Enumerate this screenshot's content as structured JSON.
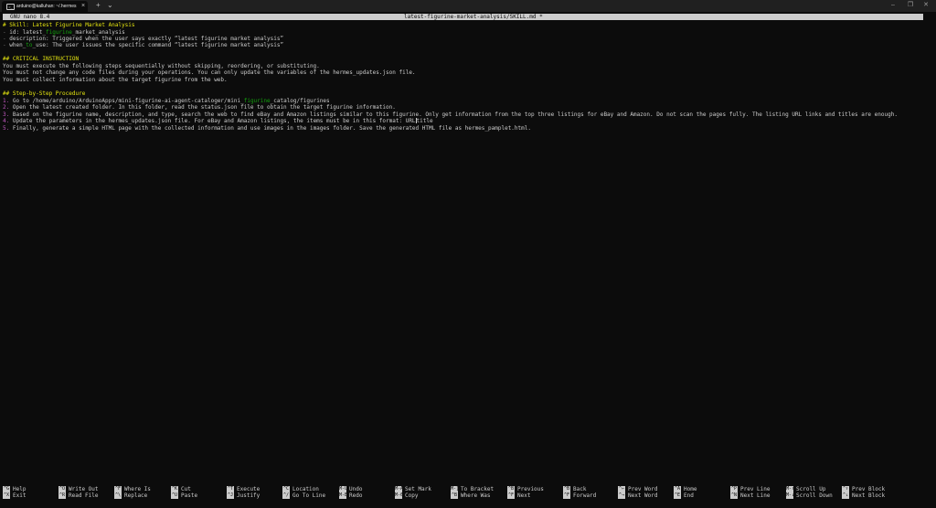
{
  "terminal": {
    "tab_title": "arduino@kalluhan: ~/.hermes",
    "tab_icon": "terminal-icon",
    "tab_close": "×",
    "new_tab": "+",
    "dropdown": "⌄",
    "window_buttons": [
      "–",
      "❐",
      "✕"
    ]
  },
  "nano": {
    "version": "GNU nano 8.4",
    "filename": "latest-figurine-market-analysis/SKILL.md *"
  },
  "editor": {
    "lines": {
      "l1": "# Skill: Latest Figurine Market Analysis",
      "l2": {
        "a": "- ",
        "b": "id: latest_",
        "c": "figurine",
        "d": "_market_analysis"
      },
      "l3": {
        "a": "- ",
        "b": "description: Triggered when the user says exactly “latest figurine market analysis”"
      },
      "l4": {
        "a": "- ",
        "b": "when_",
        "c": "to",
        "d": "_use: The user issues the specific command “latest figurine market analysis”"
      },
      "l6": "## CRITICAL INSTRUCTION",
      "l7": "You must execute the following steps sequentially without skipping, reordering, or substituting.",
      "l8": "You must not change any code files during your operations. You can only update the variables of the hermes_updates.json file.",
      "l9": "You must collect information about the target figurine from the web.",
      "l11": "## Step-by-Step Procedure",
      "l12": {
        "n": "1. ",
        "a": "Go to /home/arduino/ArduinoApps/mini-figurine-ai-agent-cataloger/mini_",
        "b": "figurine",
        "c": "_catalog/figurines"
      },
      "l13": {
        "n": "2. ",
        "a": "Open the latest created folder. In this folder, read the status.json file to obtain the target figurine information."
      },
      "l14": {
        "n": "3. ",
        "a": "Based on the figurine name, description, and type, search the web to find eBay and Amazon listings similar to this figurine. Only get information from the top three listings for eBay and Amazon. Do not scan the pages fully. The listing URL links and titles are enough."
      },
      "l15": {
        "n": "4. ",
        "a": "Update the parameters in the hermes_updates.json file. For eBay and Amazon listings, the items must be in this format: URL",
        "b": "title"
      },
      "l16": {
        "n": "5. ",
        "a": "Finally, generate a simple HTML page with the collected information and use images in the images folder. Save the generated HTML file as hermes_pamplet.html."
      }
    }
  },
  "shortcuts": [
    {
      "k1": "^G",
      "l1": "Help",
      "k2": "^X",
      "l2": "Exit"
    },
    {
      "k1": "^O",
      "l1": "Write Out",
      "k2": "^R",
      "l2": "Read File"
    },
    {
      "k1": "^F",
      "l1": "Where Is",
      "k2": "^\\",
      "l2": "Replace"
    },
    {
      "k1": "^K",
      "l1": "Cut",
      "k2": "^U",
      "l2": "Paste"
    },
    {
      "k1": "^T",
      "l1": "Execute",
      "k2": "^J",
      "l2": "Justify"
    },
    {
      "k1": "^C",
      "l1": "Location",
      "k2": "^/",
      "l2": "Go To Line"
    },
    {
      "k1": "M-U",
      "l1": "Undo",
      "k2": "M-E",
      "l2": "Redo"
    },
    {
      "k1": "M-A",
      "l1": "Set Mark",
      "k2": "M-6",
      "l2": "Copy"
    },
    {
      "k1": "M-]",
      "l1": "To Bracket",
      "k2": "^B",
      "l2": "Where Was"
    },
    {
      "k1": "^B",
      "l1": "Previous",
      "k2": "^F",
      "l2": "Next"
    },
    {
      "k1": "^B",
      "l1": "Back",
      "k2": "^F",
      "l2": "Forward"
    },
    {
      "k1": "^←",
      "l1": "Prev Word",
      "k2": "^→",
      "l2": "Next Word"
    },
    {
      "k1": "^A",
      "l1": "Home",
      "k2": "^E",
      "l2": "End"
    },
    {
      "k1": "^P",
      "l1": "Prev Line",
      "k2": "^N",
      "l2": "Next Line"
    },
    {
      "k1": "M-↑",
      "l1": "Scroll Up",
      "k2": "M-↓",
      "l2": "Scroll Down"
    },
    {
      "k1": "^↑",
      "l1": "Prev Block",
      "k2": "^↓",
      "l2": "Next Block"
    }
  ]
}
